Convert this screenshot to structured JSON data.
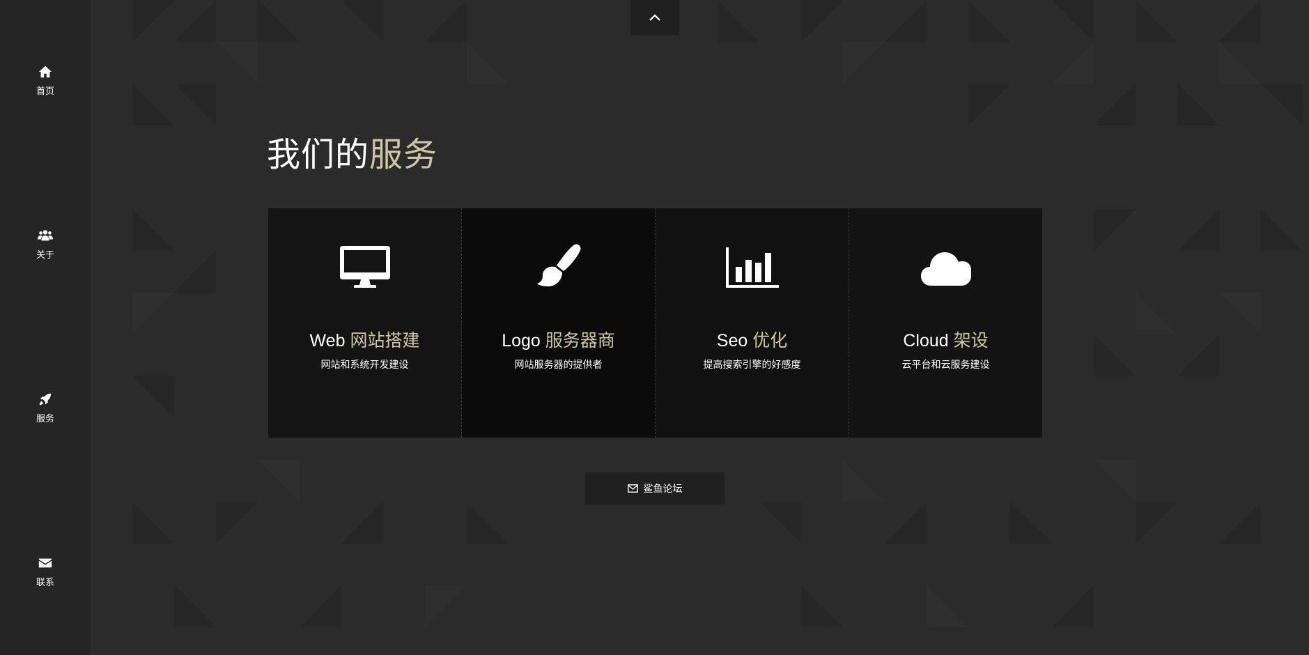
{
  "sidebar": {
    "items": [
      {
        "label": "首页",
        "icon": "home-icon"
      },
      {
        "label": "关于",
        "icon": "users-icon"
      },
      {
        "label": "服务",
        "icon": "rocket-icon"
      },
      {
        "label": "联系",
        "icon": "envelope-icon"
      }
    ]
  },
  "scroll_top": {
    "icon": "chevron-up-icon"
  },
  "section": {
    "title_main": "我们的",
    "title_highlight": "服务"
  },
  "services": [
    {
      "icon": "desktop-icon",
      "title_en": "Web",
      "title_cn": "网站搭建",
      "desc": "网站和系统开发建设"
    },
    {
      "icon": "paintbrush-icon",
      "title_en": "Logo",
      "title_cn": "服务器商",
      "desc": "网站服务器的提供者"
    },
    {
      "icon": "bar-chart-icon",
      "title_en": "Seo",
      "title_cn": "优化",
      "desc": "提高搜索引擎的好感度"
    },
    {
      "icon": "cloud-icon",
      "title_en": "Cloud",
      "title_cn": "架设",
      "desc": "云平台和云服务建设"
    }
  ],
  "forum_button": {
    "label": "鲨鱼论坛",
    "icon": "envelope-outline-icon"
  },
  "colors": {
    "background": "#2b2b2b",
    "sidebar": "#252525",
    "accent": "#cfc6a5"
  }
}
